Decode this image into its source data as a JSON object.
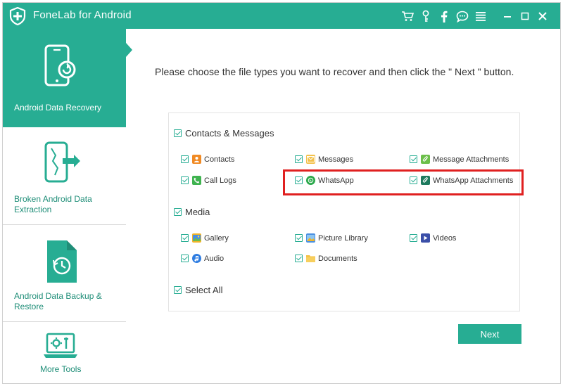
{
  "titlebar": {
    "title": "FoneLab for Android",
    "icons": [
      "cart-icon",
      "key-icon",
      "facebook-icon",
      "chat-icon",
      "menu-icon"
    ],
    "controls": [
      "minimize-icon",
      "maximize-icon",
      "close-icon"
    ]
  },
  "sidebar": {
    "items": [
      {
        "label": "Android Data Recovery",
        "icon": "phone-recovery-icon",
        "active": true
      },
      {
        "label_line1": "Broken Android Data",
        "label_line2": "Extraction",
        "icon": "broken-phone-icon"
      },
      {
        "label_line1": "Android Data Backup &",
        "label_line2": "Restore",
        "icon": "backup-restore-icon"
      },
      {
        "label": "More Tools",
        "icon": "toolbox-icon"
      }
    ]
  },
  "main": {
    "instruction": "Please choose the file types you want to recover and then click the \" Next \" button.",
    "groups": {
      "contacts_messages": {
        "label": "Contacts & Messages",
        "options": {
          "contacts": "Contacts",
          "messages": "Messages",
          "message_attachments": "Message Attachments",
          "call_logs": "Call Logs",
          "whatsapp": "WhatsApp",
          "whatsapp_attachments": "WhatsApp Attachments"
        }
      },
      "media": {
        "label": "Media",
        "options": {
          "gallery": "Gallery",
          "picture_library": "Picture Library",
          "videos": "Videos",
          "audio": "Audio",
          "documents": "Documents"
        }
      },
      "select_all": "Select All"
    },
    "next_label": "Next"
  },
  "colors": {
    "accent": "#27ad93",
    "highlight": "#e02020"
  }
}
